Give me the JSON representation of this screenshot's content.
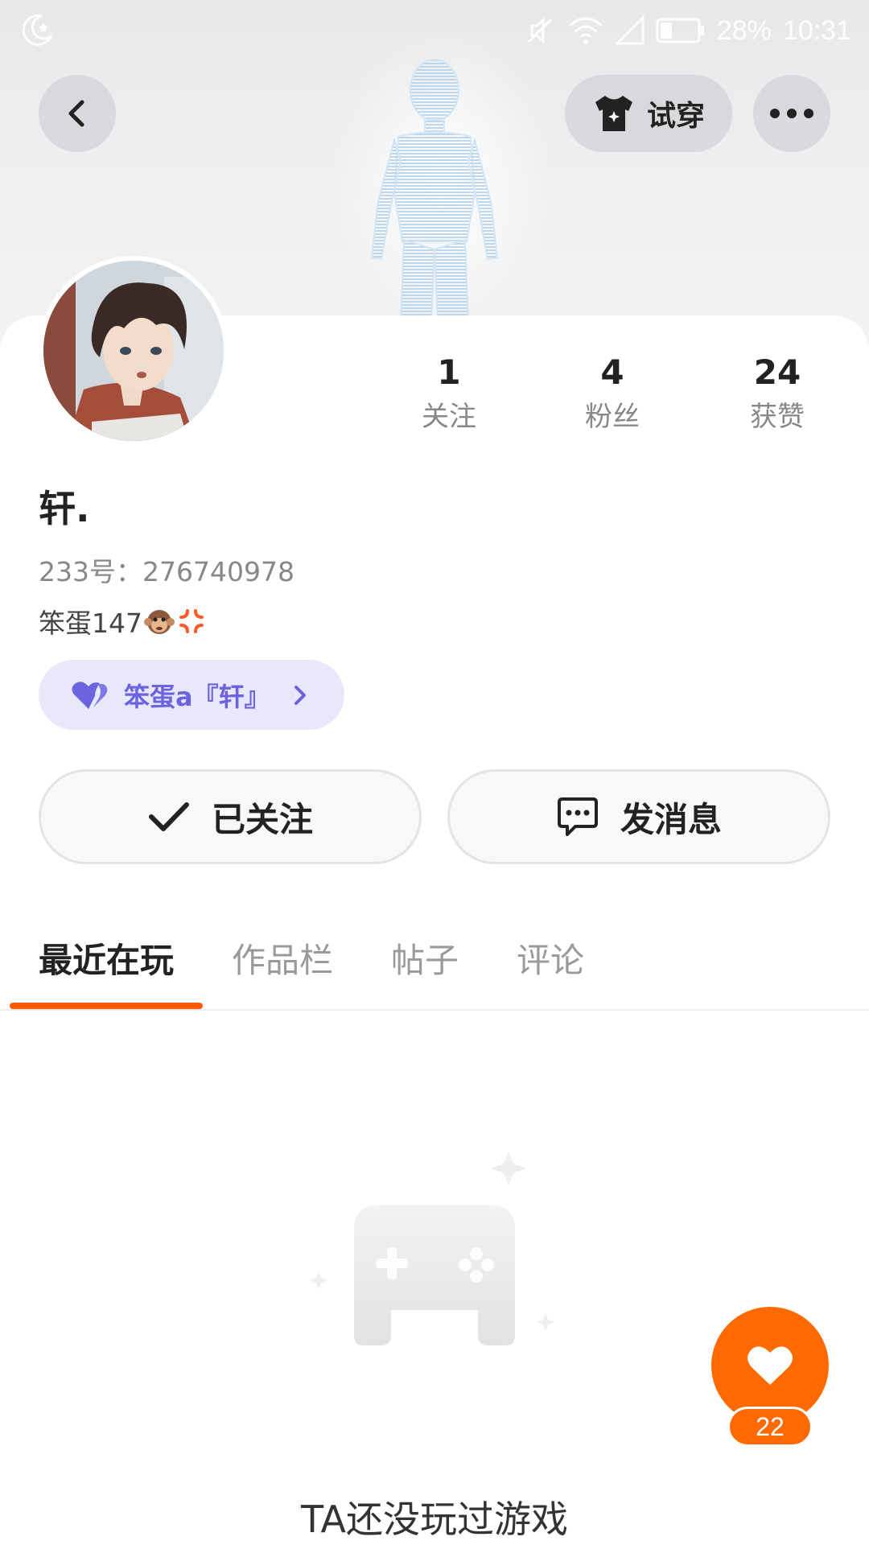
{
  "status_bar": {
    "battery": "28%",
    "time": "10:31",
    "icons": [
      "moon-icon",
      "mute-icon",
      "wifi-icon",
      "signal-icon",
      "battery-icon"
    ]
  },
  "header": {
    "tryon_label": "试穿",
    "icons": {
      "back": "chevron-left-icon",
      "tryon": "tshirt-icon",
      "more": "more-dots-icon"
    }
  },
  "profile": {
    "name": "轩.",
    "id_line": "233号：276740978",
    "bio": "笨蛋147",
    "bio_emojis": [
      "monkey-emoji",
      "anger-emoji"
    ],
    "club": {
      "label": "笨蛋a『轩』",
      "icon": "heart-pair-icon"
    }
  },
  "stats": [
    {
      "value": "1",
      "label": "关注"
    },
    {
      "value": "4",
      "label": "粉丝"
    },
    {
      "value": "24",
      "label": "获赞"
    }
  ],
  "actions": {
    "follow_label": "已关注",
    "message_label": "发消息"
  },
  "tabs": [
    {
      "label": "最近在玩",
      "active": true
    },
    {
      "label": "作品栏",
      "active": false
    },
    {
      "label": "帖子",
      "active": false
    },
    {
      "label": "评论",
      "active": false
    }
  ],
  "empty_state": {
    "text": "TA还没玩过游戏",
    "icon": "gamepad-icon"
  },
  "like_fab": {
    "count": "22",
    "icon": "heart-icon"
  },
  "colors": {
    "accent": "#ff6a00",
    "tab_indicator": "#ff5a00",
    "club_text": "#6b63e0",
    "club_bg": "#e9e8fb"
  }
}
